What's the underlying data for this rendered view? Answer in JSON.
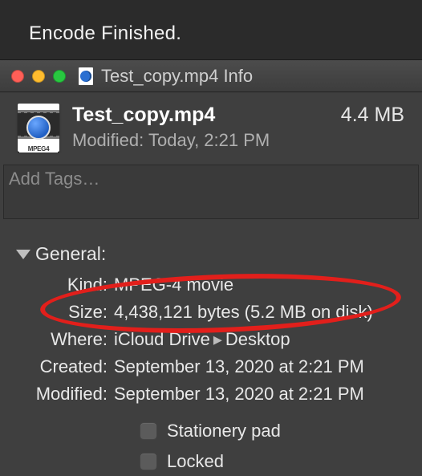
{
  "status": "Encode Finished.",
  "window": {
    "title": "Test_copy.mp4 Info"
  },
  "header": {
    "filename": "Test_copy.mp4",
    "size_display": "4.4 MB",
    "modified_label": "Modified:",
    "modified_value": "Today, 2:21 PM",
    "icon_badge": "MPEG4"
  },
  "tags": {
    "placeholder": "Add Tags…"
  },
  "general": {
    "section_label": "General:",
    "kind_label": "Kind:",
    "kind_value": "MPEG-4 movie",
    "size_label": "Size:",
    "size_value": "4,438,121 bytes (5.2 MB on disk)",
    "where_label": "Where:",
    "where_value_a": "iCloud Drive",
    "where_value_b": "Desktop",
    "created_label": "Created:",
    "created_value": "September 13, 2020 at 2:21 PM",
    "modified_label": "Modified:",
    "modified_value": "September 13, 2020 at 2:21 PM",
    "stationery_label": "Stationery pad",
    "locked_label": "Locked"
  }
}
